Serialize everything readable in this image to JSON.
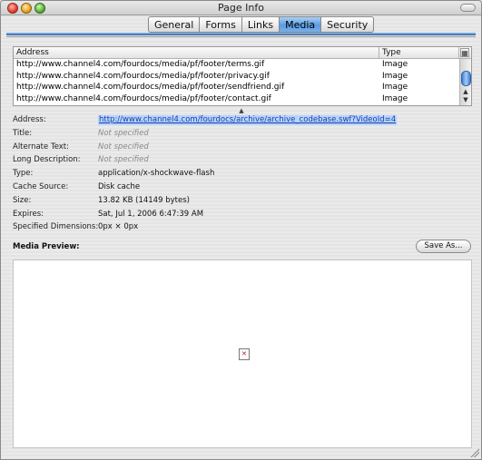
{
  "window": {
    "title": "Page Info"
  },
  "tabs": [
    {
      "label": "General",
      "active": false
    },
    {
      "label": "Forms",
      "active": false
    },
    {
      "label": "Links",
      "active": false
    },
    {
      "label": "Media",
      "active": true
    },
    {
      "label": "Security",
      "active": false
    }
  ],
  "media_table": {
    "columns": {
      "address": "Address",
      "type": "Type"
    },
    "rows": [
      {
        "address": "http://www.channel4.com/fourdocs/media/pf/footer/terms.gif",
        "type": "Image"
      },
      {
        "address": "http://www.channel4.com/fourdocs/media/pf/footer/privacy.gif",
        "type": "Image"
      },
      {
        "address": "http://www.channel4.com/fourdocs/media/pf/footer/sendfriend.gif",
        "type": "Image"
      },
      {
        "address": "http://www.channel4.com/fourdocs/media/pf/footer/contact.gif",
        "type": "Image"
      }
    ]
  },
  "details": {
    "address": {
      "label": "Address:",
      "value": "http://www.channel4.com/fourdocs/archive/archive_codebase.swf?VideoId=4"
    },
    "title": {
      "label": "Title:",
      "value": "Not specified"
    },
    "alt_text": {
      "label": "Alternate Text:",
      "value": "Not specified"
    },
    "long_desc": {
      "label": "Long Description:",
      "value": "Not specified"
    },
    "type": {
      "label": "Type:",
      "value": "application/x-shockwave-flash"
    },
    "cache_source": {
      "label": "Cache Source:",
      "value": "Disk cache"
    },
    "size": {
      "label": "Size:",
      "value": "13.82 KB (14149 bytes)"
    },
    "expires": {
      "label": "Expires:",
      "value": "Sat, Jul 1, 2006 6:47:39 AM"
    },
    "dimensions": {
      "label": "Specified Dimensions:",
      "value": "0px × 0px"
    }
  },
  "preview": {
    "label": "Media Preview:",
    "save_button": "Save As..."
  },
  "icons": {
    "close": "close-icon",
    "minimize": "minimize-icon",
    "zoom": "zoom-icon",
    "column_picker": "column-picker-icon",
    "missing_plugin": "missing-plugin-icon"
  }
}
